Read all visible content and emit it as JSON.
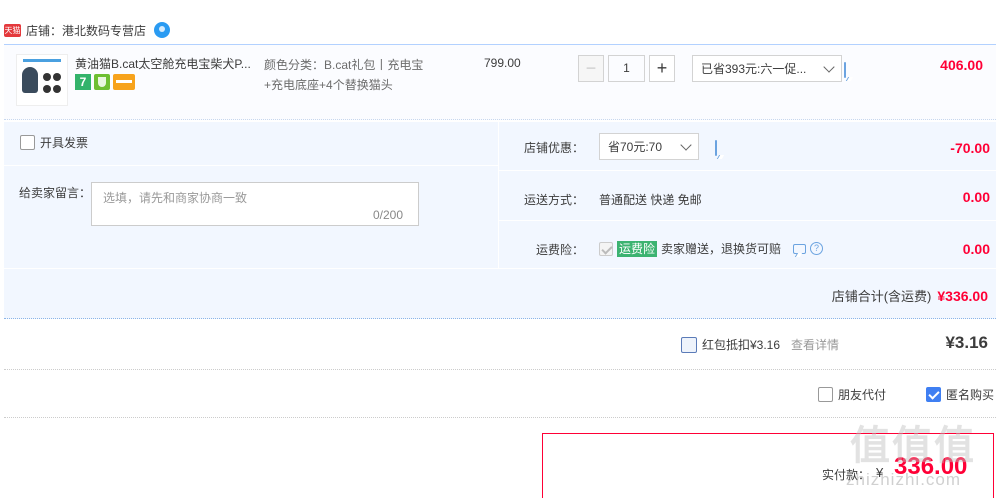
{
  "shop": {
    "tmall_tag": "天猫",
    "name": "店铺：港北数码专营店"
  },
  "item": {
    "title": "黄油猫B.cat太空舱充电宝柴犬P...",
    "badge_seven": "7",
    "sku_line1": "颜色分类：B.cat礼包丨充电宝",
    "sku_line2": "+充电底座+4个替换猫头",
    "unit_price": "799.00",
    "quantity": "1",
    "promo_label": "已省393元:六一促...",
    "total": "406.00"
  },
  "options": {
    "invoice_label": "开具发票",
    "note_label": "给卖家留言：",
    "note_placeholder": "选填，请先和商家协商一致",
    "note_count": "0/200",
    "shop_discount_label": "店铺优惠：",
    "shop_discount_value": "省70元:70",
    "shop_discount_amount": "-70.00",
    "shipping_label": "运送方式：",
    "shipping_value": "普通配送 快递 免邮",
    "shipping_amount": "0.00",
    "insurance_label": "运费险：",
    "insurance_tag": "运费险",
    "insurance_text": "卖家赠送，退换货可赔",
    "insurance_amount": "0.00"
  },
  "shop_total": {
    "label": "店铺合计(含运费)",
    "amount": "¥336.00"
  },
  "red_packet": {
    "label": "红包抵扣¥3.16",
    "link": "查看详情",
    "amount": "¥3.16"
  },
  "flags": {
    "friend_pay": "朋友代付",
    "anonymous": "匿名购买"
  },
  "payment": {
    "label": "实付款：",
    "currency": "¥",
    "amount": "336.00"
  },
  "watermark": {
    "big": "值值值",
    "small": "zhizhizhi.com"
  },
  "colors": {
    "accent_red": "#ff0036",
    "panel_blue": "#f2f7ff",
    "checkbox_blue": "#3f7ff2"
  }
}
